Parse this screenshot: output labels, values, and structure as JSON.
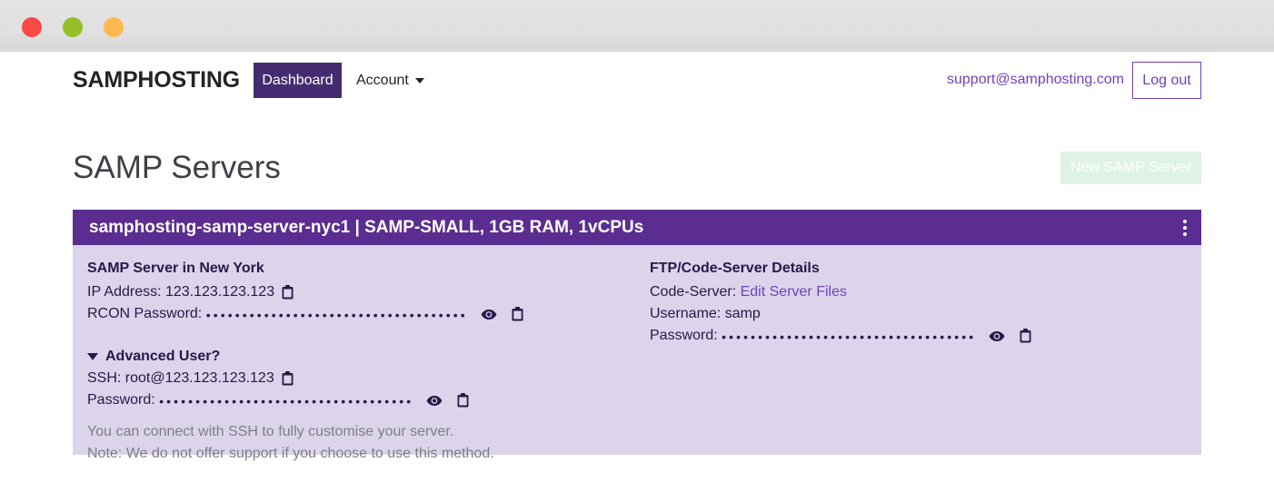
{
  "chrome": {
    "lights": [
      {
        "name": "close-button",
        "color": "#fc4a45"
      },
      {
        "name": "minimize-button",
        "color": "#95bf27"
      },
      {
        "name": "maximize-button",
        "color": "#fdb950"
      }
    ]
  },
  "navbar": {
    "brand": "SAMPHOSTING",
    "dashboard_label": "Dashboard",
    "account_label": "Account",
    "account_caret_icon": "chevron-down-icon",
    "email": "support@samphosting.com",
    "logout_label": "Log out",
    "accent_color": "#452c70",
    "link_color": "#6f42c1"
  },
  "content": {
    "page_title": "SAMP Servers",
    "new_server_label": "New SAMP Server",
    "new_server_bg": "#dff3e4"
  },
  "server_card": {
    "header_title": "samphosting-samp-server-nyc1 | SAMP-SMALL, 1GB RAM, 1vCPUs",
    "header_bg": "#5b2d90",
    "body_bg": "#dcd4ea",
    "menu_icon": "kebab-menu-icon",
    "left": {
      "heading": "SAMP Server in New York",
      "ip_label": "IP Address:",
      "ip_value": "123.123.123.123",
      "ip_copy_icon": "clipboard-icon",
      "rcon_label": "RCON Password:",
      "rcon_value": "••••••••••••••••••••••••••••••••••••",
      "rcon_eye_icon": "eye-icon",
      "rcon_copy_icon": "clipboard-icon",
      "advanced_label": "Advanced User?",
      "advanced_caret_icon": "triangle-down-icon",
      "ssh_label": "SSH:",
      "ssh_value": "root@123.123.123.123",
      "ssh_copy_icon": "clipboard-icon",
      "ssh_password_label": "Password:",
      "ssh_password_value": "•••••••••••••••••••••••••••••••••••",
      "ssh_eye_icon": "eye-icon",
      "ssh_copy_password_icon": "clipboard-icon",
      "note_line_1": "You can connect with SSH to fully customise your server.",
      "note_line_2": "Note: We do not offer support if you choose to use this method."
    },
    "right": {
      "heading": "FTP/Code-Server Details",
      "code_server_label": "Code-Server:",
      "code_server_link": "Edit Server Files",
      "username_label": "Username:",
      "username_value": "samp",
      "password_label": "Password:",
      "password_value": "•••••••••••••••••••••••••••••••••••",
      "password_eye_icon": "eye-icon",
      "password_copy_icon": "clipboard-icon"
    }
  }
}
